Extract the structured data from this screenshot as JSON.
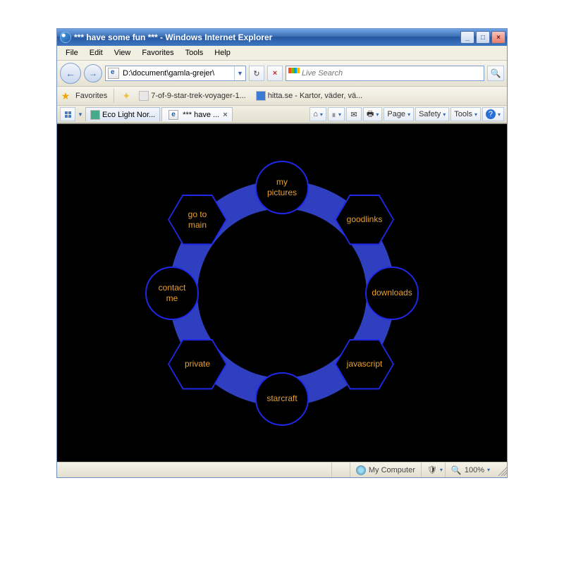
{
  "titlebar": {
    "title": "*** have some fun *** - Windows Internet Explorer"
  },
  "menubar": {
    "file": "File",
    "edit": "Edit",
    "view": "View",
    "favorites": "Favorites",
    "tools": "Tools",
    "help": "Help"
  },
  "nav": {
    "address": "D:\\document\\gamla-grejer\\",
    "search_placeholder": "Live Search"
  },
  "favorites": {
    "label": "Favorites",
    "link1": "7-of-9-star-trek-voyager-1...",
    "link2": "hitta.se - Kartor, väder, vä..."
  },
  "tabs": {
    "tab1": "Eco Light Nor...",
    "tab2": "*** have ..."
  },
  "cmdbar": {
    "page": "Page",
    "safety": "Safety",
    "tools": "Tools"
  },
  "ring_nodes": {
    "top": "my\npictures",
    "tr": "goodlinks",
    "r": "downloads",
    "br": "javascript",
    "b": "starcraft",
    "bl": "private",
    "l": "contact\nme",
    "tl": "go to\nmain"
  },
  "status": {
    "zone": "My Computer",
    "zoom": "100%"
  }
}
